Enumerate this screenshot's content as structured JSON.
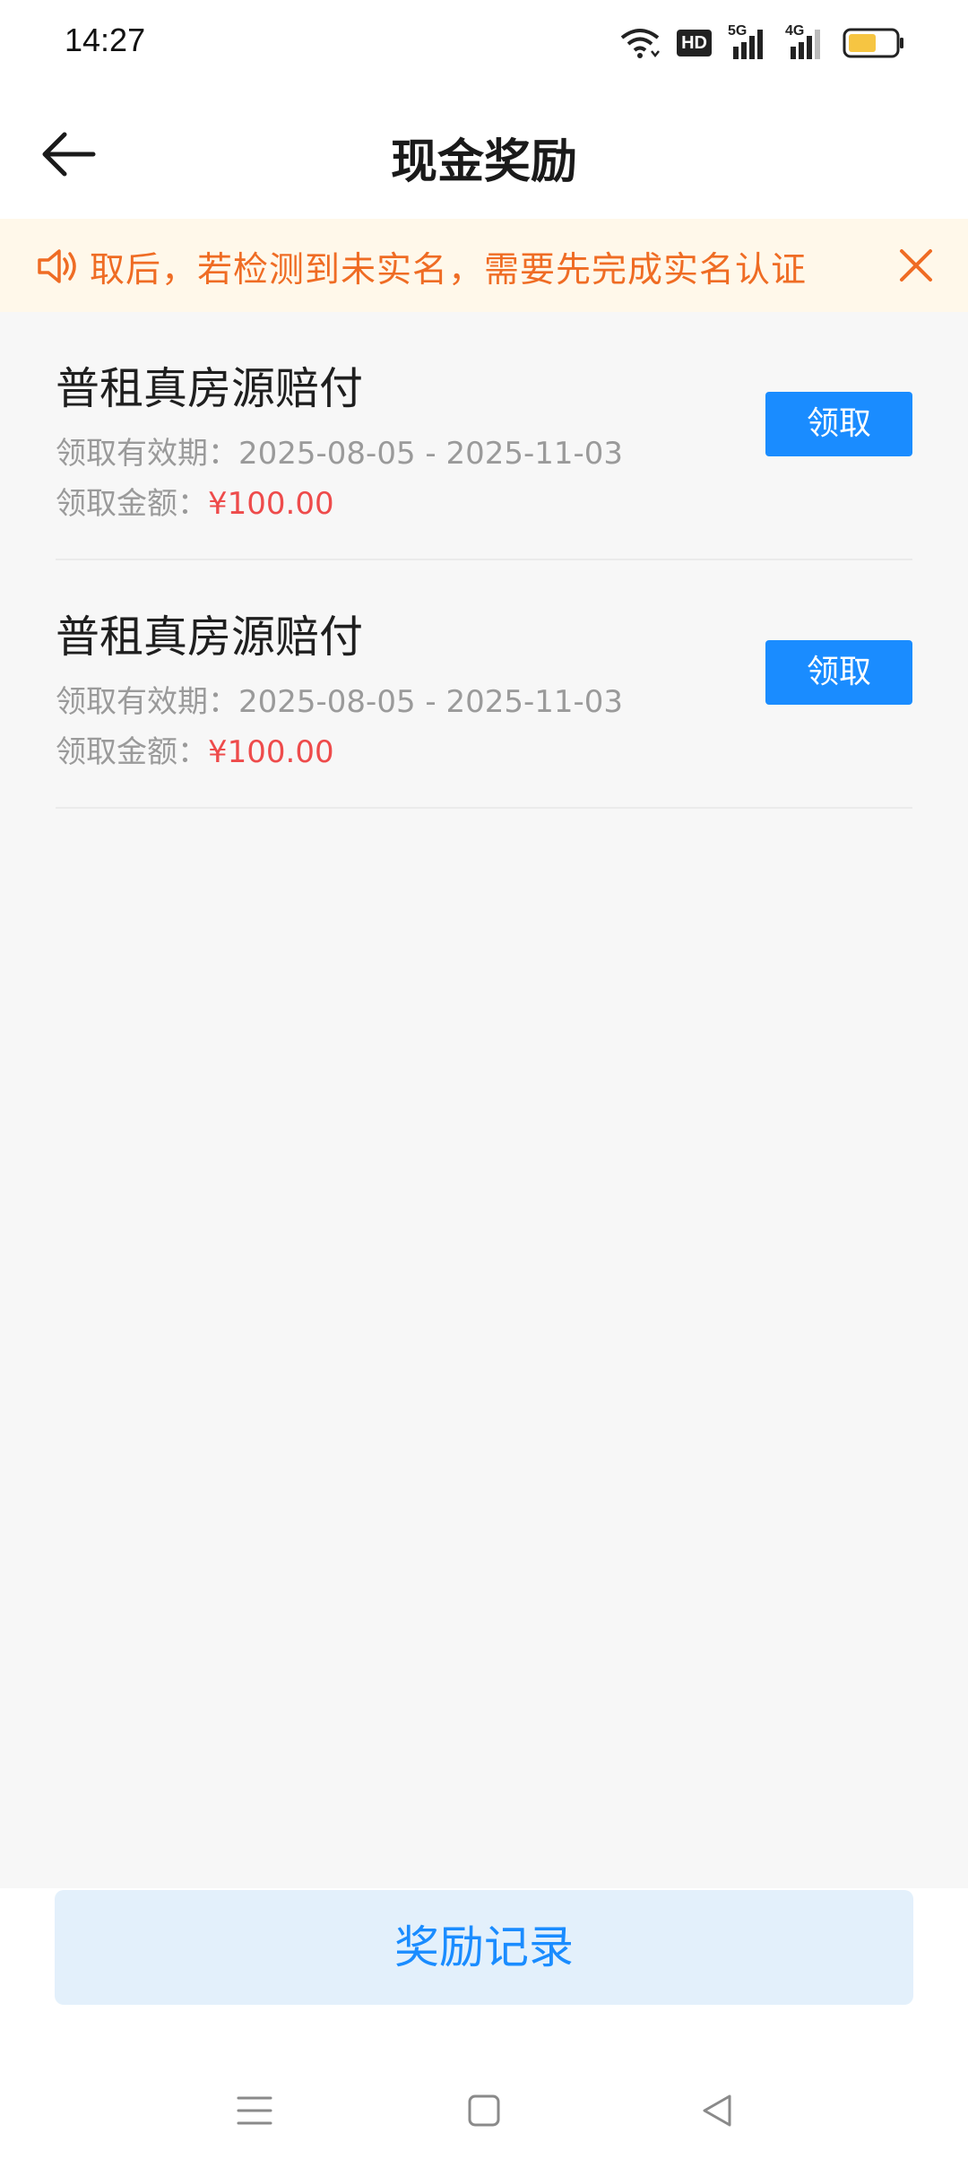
{
  "status_bar": {
    "time": "14:27",
    "icons": [
      "wifi-icon",
      "hd-icon",
      "signal-5g-icon",
      "signal-4g-icon",
      "battery-icon"
    ],
    "hd_label": "HD",
    "net1_label": "5G",
    "net2_label": "4G",
    "battery_color": "#f6c542"
  },
  "header": {
    "title": "现金奖励",
    "back_icon": "arrow-left-icon"
  },
  "notice": {
    "icon": "speaker-icon",
    "text": "取后，若检测到未实名，需要先完成实名认证",
    "close_icon": "close-icon",
    "color": "#ef6c24"
  },
  "rewards": [
    {
      "title": "普租真房源赔付",
      "validity_label": "领取有效期：",
      "validity": "2025-08-05 - 2025-11-03",
      "amount_label": "领取金额：",
      "amount": "¥100.00",
      "button": "领取"
    },
    {
      "title": "普租真房源赔付",
      "validity_label": "领取有效期：",
      "validity": "2025-08-05 - 2025-11-03",
      "amount_label": "领取金额：",
      "amount": "¥100.00",
      "button": "领取"
    }
  ],
  "footer": {
    "record_button": "奖励记录"
  },
  "nav": {
    "icons": [
      "menu-icon",
      "home-icon",
      "back-triangle-icon"
    ]
  },
  "colors": {
    "accent": "#1a8cff",
    "amount": "#ee4b4b",
    "notice_bg": "#fff8ea"
  }
}
